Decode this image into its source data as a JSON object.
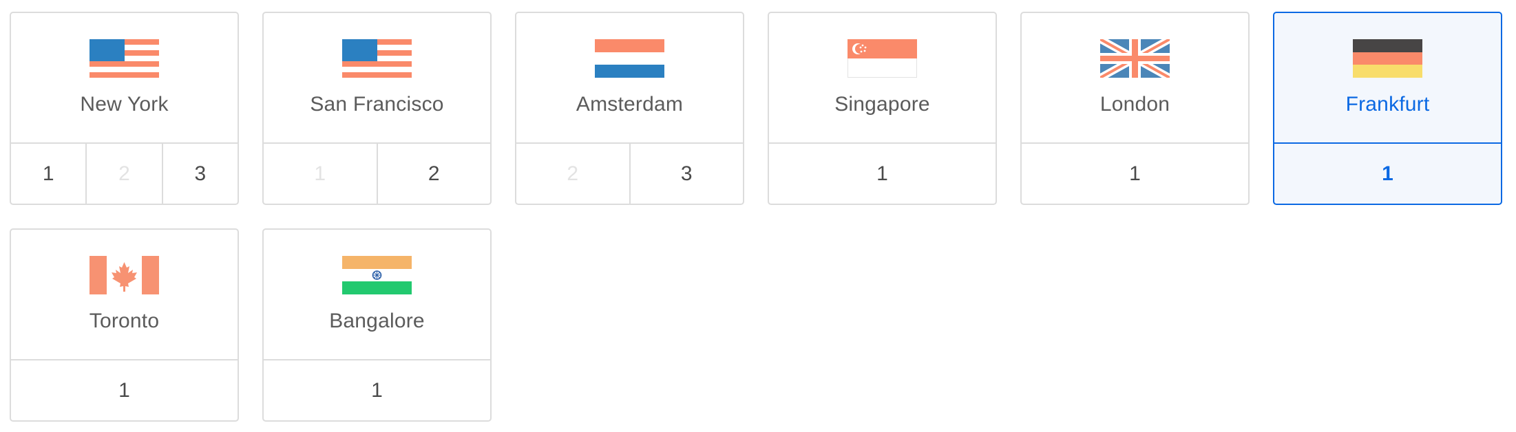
{
  "regions": [
    {
      "name": "New York",
      "flag": "usa-flag-icon",
      "datacenters": [
        {
          "label": "1",
          "available": true
        },
        {
          "label": "2",
          "available": false
        },
        {
          "label": "3",
          "available": true
        }
      ]
    },
    {
      "name": "San Francisco",
      "flag": "usa-flag-icon",
      "datacenters": [
        {
          "label": "1",
          "available": false
        },
        {
          "label": "2",
          "available": true
        }
      ]
    },
    {
      "name": "Amsterdam",
      "flag": "netherlands-flag-icon",
      "datacenters": [
        {
          "label": "2",
          "available": false
        },
        {
          "label": "3",
          "available": true
        }
      ]
    },
    {
      "name": "Singapore",
      "flag": "singapore-flag-icon",
      "datacenters": [
        {
          "label": "1",
          "available": true
        }
      ]
    },
    {
      "name": "London",
      "flag": "uk-flag-icon",
      "datacenters": [
        {
          "label": "1",
          "available": true
        }
      ]
    },
    {
      "name": "Frankfurt",
      "flag": "germany-flag-icon",
      "selected": true,
      "datacenters": [
        {
          "label": "1",
          "available": true
        }
      ]
    },
    {
      "name": "Toronto",
      "flag": "canada-flag-icon",
      "datacenters": [
        {
          "label": "1",
          "available": true
        }
      ]
    },
    {
      "name": "Bangalore",
      "flag": "india-flag-icon",
      "datacenters": [
        {
          "label": "1",
          "available": true
        }
      ]
    }
  ],
  "colors": {
    "selected_accent": "#0b69e3",
    "card_border": "#dcdcdc",
    "text": "#5b5b5b",
    "disabled_text": "#e3e3e3"
  }
}
